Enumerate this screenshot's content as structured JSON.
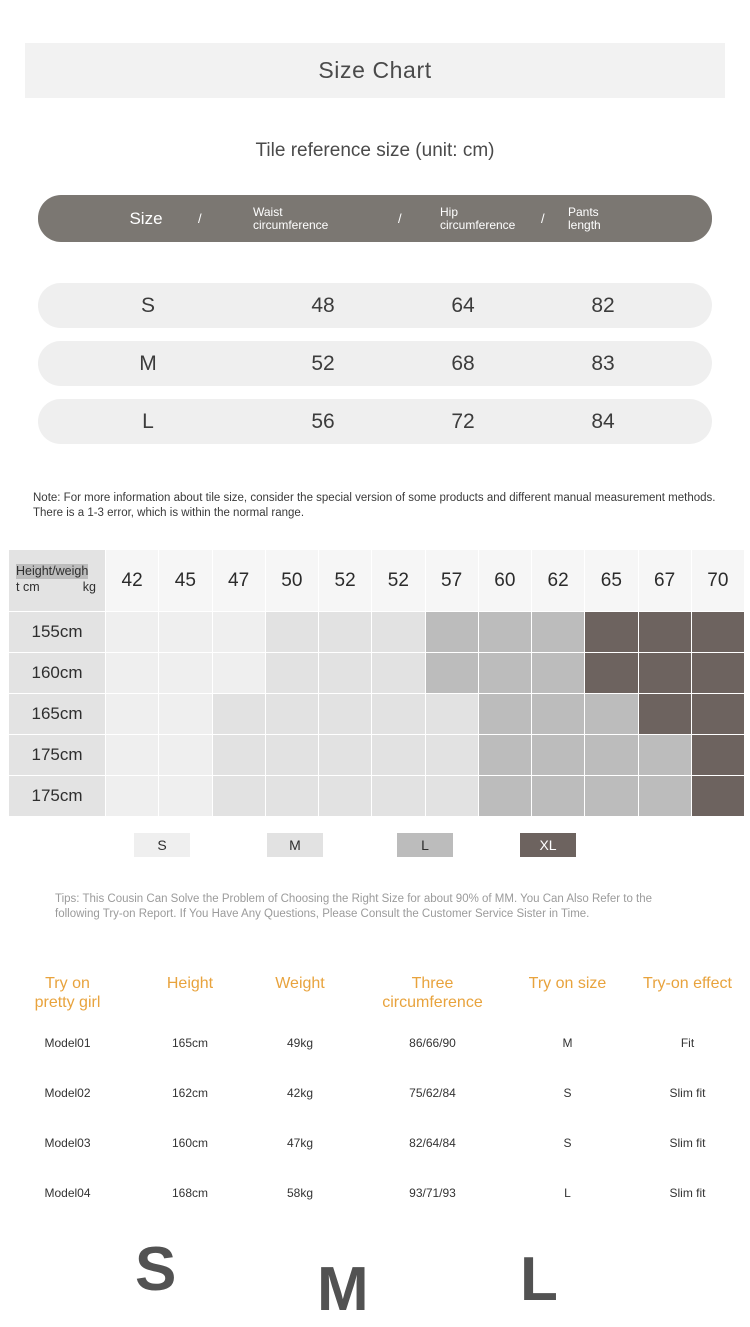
{
  "title": "Size Chart",
  "subtitle": "Tile reference size (unit: cm)",
  "size_table": {
    "headers": {
      "size": "Size",
      "sep1": "/",
      "waist_line1": "Waist",
      "waist_line2": "circumference",
      "sep2": "/",
      "hip_line1": "Hip",
      "hip_line2": "circumference",
      "sep3": "/",
      "pants_line1": "Pants",
      "pants_line2": "length"
    },
    "rows": [
      {
        "size": "S",
        "waist": "48",
        "hip": "64",
        "pants": "82"
      },
      {
        "size": "M",
        "waist": "52",
        "hip": "68",
        "pants": "83"
      },
      {
        "size": "L",
        "waist": "56",
        "hip": "72",
        "pants": "84"
      }
    ]
  },
  "note": "Note: For more information about tile size, consider the special version of some products and different manual measurement methods. There is a 1-3 error, which is within the normal range.",
  "matrix": {
    "corner_line1": "Height/weigh",
    "corner_line2": "t cm",
    "corner_line2_right": "kg",
    "weights": [
      "42",
      "45",
      "47",
      "50",
      "52",
      "52",
      "57",
      "60",
      "62",
      "65",
      "67",
      "70"
    ],
    "heights": [
      "155cm",
      "160cm",
      "165cm",
      "175cm",
      "175cm"
    ],
    "cells": [
      [
        "s",
        "s",
        "s",
        "m",
        "m",
        "m",
        "l",
        "l",
        "l",
        "xl",
        "xl",
        "xl"
      ],
      [
        "s",
        "s",
        "s",
        "m",
        "m",
        "m",
        "l",
        "l",
        "l",
        "xl",
        "xl",
        "xl"
      ],
      [
        "s",
        "s",
        "m",
        "m",
        "m",
        "m",
        "m",
        "l",
        "l",
        "l",
        "xl",
        "xl"
      ],
      [
        "s",
        "s",
        "m",
        "m",
        "m",
        "m",
        "m",
        "l",
        "l",
        "l",
        "l",
        "xl"
      ],
      [
        "s",
        "s",
        "m",
        "m",
        "m",
        "m",
        "m",
        "l",
        "l",
        "l",
        "l",
        "xl"
      ]
    ],
    "overlay_labels": [
      "S",
      "M",
      "L",
      "XL"
    ],
    "colors": {
      "s": "#efefef",
      "m": "#e2e2e2",
      "l": "#bcbcbc",
      "xl": "#6d635f"
    }
  },
  "legend": [
    {
      "label": "S",
      "key": "s"
    },
    {
      "label": "M",
      "key": "m"
    },
    {
      "label": "L",
      "key": "l"
    },
    {
      "label": "XL",
      "key": "xl"
    }
  ],
  "tips": "Tips: This Cousin Can Solve the Problem of Choosing the Right Size for about 90% of MM. You Can Also Refer to the following Try-on Report. If You Have Any Questions, Please Consult the Customer Service Sister in Time.",
  "report": {
    "headers": {
      "girl_line1": "Try on",
      "girl_line2": "pretty girl",
      "height": "Height",
      "weight": "Weight",
      "three_line1": "Three",
      "three_line2": "circumference",
      "size": "Try on size",
      "effect": "Try-on effect"
    },
    "rows": [
      {
        "model": "Model01",
        "height": "165cm",
        "weight": "49kg",
        "three": "86/66/90",
        "size": "M",
        "effect": "Fit"
      },
      {
        "model": "Model02",
        "height": "162cm",
        "weight": "42kg",
        "three": "75/62/84",
        "size": "S",
        "effect": "Slim fit"
      },
      {
        "model": "Model03",
        "height": "160cm",
        "weight": "47kg",
        "three": "82/64/84",
        "size": "S",
        "effect": "Slim fit"
      },
      {
        "model": "Model04",
        "height": "168cm",
        "weight": "58kg",
        "three": "93/71/93",
        "size": "L",
        "effect": "Slim fit"
      }
    ]
  },
  "accent_color": "#e8a33d"
}
